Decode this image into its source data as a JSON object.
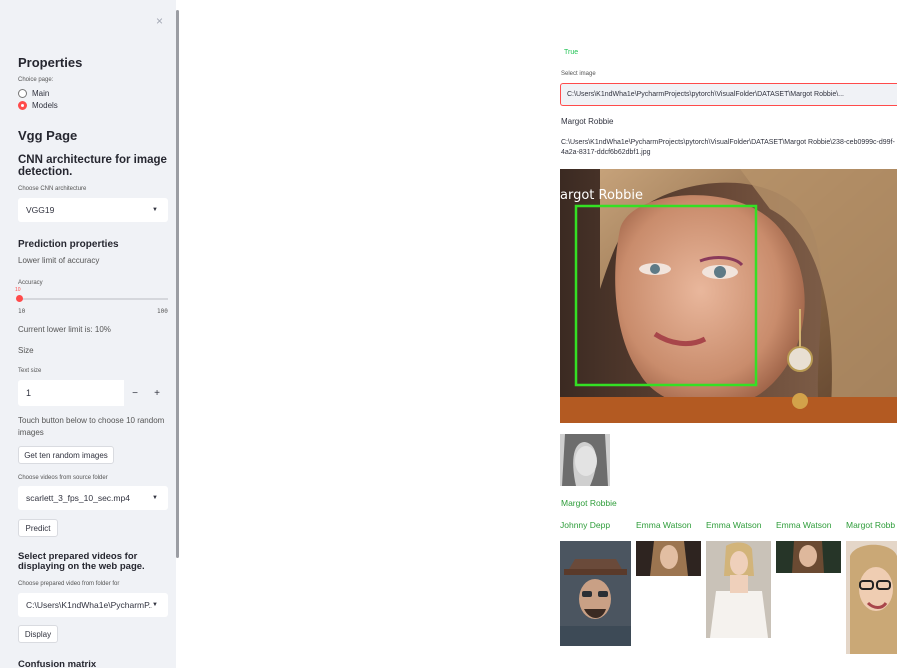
{
  "sidebar": {
    "close_glyph": "×",
    "properties_heading": "Properties",
    "choice_page_label": "Choice page:",
    "radio_options": [
      {
        "label": "Main",
        "selected": false
      },
      {
        "label": "Models",
        "selected": true
      }
    ],
    "page_heading": "Vgg Page",
    "cnn_heading": "CNN architecture for image detection.",
    "cnn_select_label": "Choose CNN architecture",
    "cnn_select_value": "VGG19",
    "prediction_heading": "Prediction properties",
    "lower_limit_text": "Lower limit of accuracy",
    "accuracy_label": "Accuracy",
    "slider_value": "10",
    "slider_min": "10",
    "slider_max": "100",
    "current_limit_text": "Current lower limit is: 10%",
    "size_text": "Size",
    "text_size_label": "Text size",
    "text_size_value": "1",
    "minus_label": "−",
    "plus_label": "+",
    "touch_text": "Touch button below to choose 10 random images",
    "random_button": "Get ten random images",
    "videos_label": "Choose videos from source folder",
    "videos_value": "scarlett_3_fps_10_sec.mp4",
    "predict_button": "Predict",
    "prepared_heading": "Select prepared videos for displaying on the web page.",
    "prepared_label": "Choose prepared video from folder for",
    "prepared_value": "C:\\Users\\K1ndWha1e\\PycharmP...",
    "display_button": "Display",
    "confusion_heading": "Confusion matrix"
  },
  "main": {
    "true_text": "True",
    "select_image_label": "Select image",
    "image_path_value": "C:\\Users\\K1ndWha1e\\PycharmProjects\\pytorch\\VisualFolder\\DATASET\\Margot Robbie\\...",
    "predicted_name": "Margot Robbie",
    "full_path": "C:\\Users\\K1ndWha1e\\PycharmProjects\\pytorch\\VisualFolder\\DATASET\\Margot Robbie\\238-ceb0999c-d99f-4a2a-8317-ddcf6b62dbf1.jpg",
    "overlay_label": "argot  Robbie",
    "thumb_caption": "Margot Robbie",
    "results": [
      {
        "name": "Johnny Depp"
      },
      {
        "name": "Emma Watson"
      },
      {
        "name": "Emma Watson"
      },
      {
        "name": "Emma Watson"
      },
      {
        "name": "Margot Robb"
      }
    ]
  },
  "colors": {
    "accent": "#ff4b4b",
    "green": "#2e9d3a",
    "detection_box": "#34e024",
    "sidebar_bg": "#f0f2f6"
  }
}
